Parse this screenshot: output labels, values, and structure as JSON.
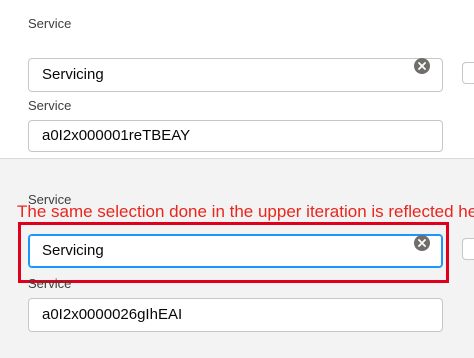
{
  "upper_iteration": {
    "service_label": "Service",
    "service_value": "Servicing",
    "service_id_label": "Service",
    "service_id_value": "a0I2x000001reTBEAY"
  },
  "lower_iteration": {
    "service_label": "Service",
    "service_value": "Servicing",
    "service_id_label": "Service",
    "service_id_value": "a0I2x0000026gIhEAI"
  },
  "annotation": {
    "text": "The same selection done in the upper iteration is reflected he"
  },
  "colors": {
    "annotation_text": "#e8261e",
    "highlight_border": "#e0001b",
    "focus_border": "#1b96ff"
  },
  "icons": {
    "clear": "close-circle-icon"
  }
}
